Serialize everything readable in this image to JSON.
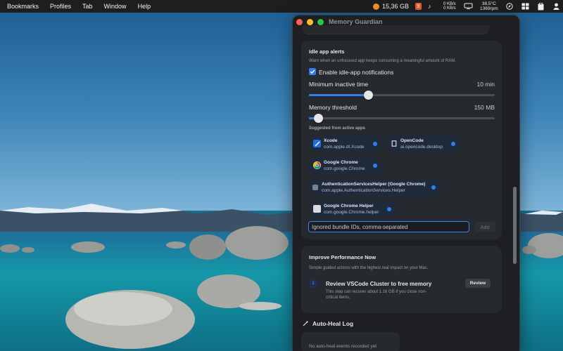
{
  "menubar": {
    "items": [
      "Bookmarks",
      "Profiles",
      "Tab",
      "Window",
      "Help"
    ],
    "memory": "15,36 GB",
    "badge_count": "9",
    "net_up": "0 KB/s",
    "net_down": "0 KB/s",
    "temp": "38,5°C",
    "rpm": "1369rpm",
    "icons": [
      "memory-dot-icon",
      "app-badge-icon",
      "music-note-icon",
      "display-icon",
      "compass-icon",
      "window-grid-icon",
      "clipboard-icon",
      "user-icon"
    ]
  },
  "window": {
    "title": "Memory Guardian",
    "traffic_lights": {
      "close": "#ff5f57",
      "minimize": "#febc2e",
      "zoom": "#28c840"
    }
  },
  "idle": {
    "title": "Idle app alerts",
    "description": "Warn when an unfocused app keeps consuming a meaningful amount of RAM.",
    "enable_label": "Enable idle-app notifications",
    "enable_checked": true,
    "min_inactive_label": "Minimum inactive time",
    "min_inactive_value": "10 min",
    "min_inactive_fraction": 0.32,
    "mem_threshold_label": "Memory threshold",
    "mem_threshold_value": "150 MB",
    "mem_threshold_fraction": 0.05,
    "suggested_label": "Suggested from active apps",
    "apps": [
      {
        "name": "Xcode",
        "bundle": "com.apple.dt.Xcode",
        "icon": "xcode-icon"
      },
      {
        "name": "OpenCode",
        "bundle": "ai.opencode.desktop",
        "icon": "opencode-icon"
      },
      {
        "name": "Google Chrome",
        "bundle": "com.google.Chrome",
        "icon": "chrome-icon"
      },
      {
        "name": "AuthenticationServicesHelper (Google Chrome)",
        "bundle": "com.apple.AuthenticationServices.Helper",
        "icon": "helper-app-icon"
      },
      {
        "name": "Google Chrome Helper",
        "bundle": "com.google.Chrome.helper",
        "icon": "chrome-helper-icon"
      }
    ],
    "input_placeholder": "Ignored bundle IDs, comma-separated",
    "add_label": "Add"
  },
  "perf": {
    "title": "Improve Performance Now",
    "description": "Simple guided actions with the highest real impact on your Mac.",
    "step_number": "1",
    "step_title": "Review VSCode Cluster to free memory",
    "step_line1": "This step can recover about 1,16 GB if you close non-",
    "step_line2": "critical items.",
    "review_label": "Review"
  },
  "log": {
    "title": "Auto-Heal Log",
    "empty": "No auto-heal events recorded yet"
  },
  "colors": {
    "accent": "#2f80ed",
    "window_bg": "#1d1f22",
    "card_bg": "#26292d"
  }
}
